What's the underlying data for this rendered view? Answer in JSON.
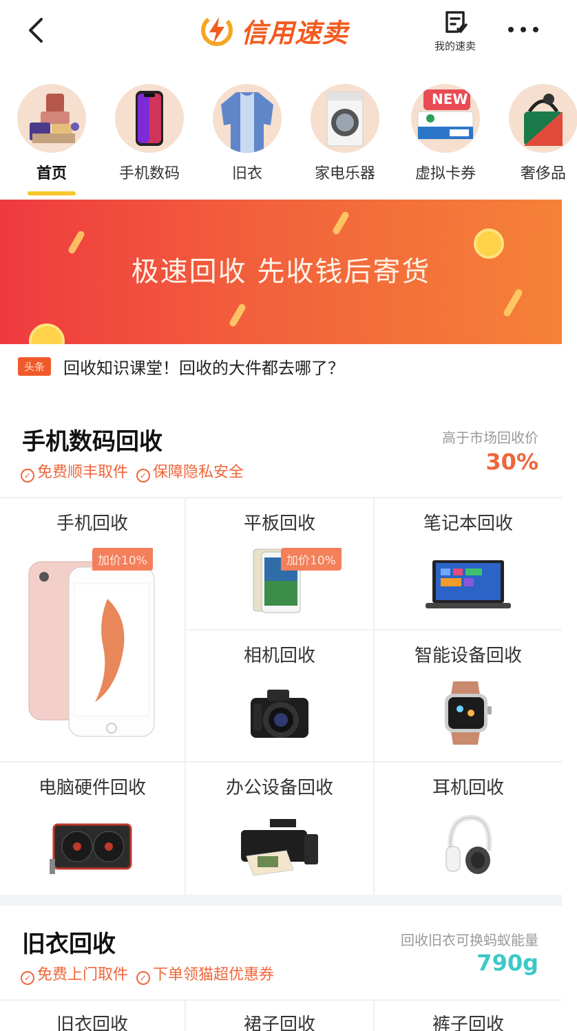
{
  "header": {
    "logo_text": "信用速卖",
    "my_sell_label": "我的速卖"
  },
  "categories": [
    {
      "label": "首页",
      "active": true
    },
    {
      "label": "手机数码",
      "active": false
    },
    {
      "label": "旧衣",
      "active": false
    },
    {
      "label": "家电乐器",
      "active": false
    },
    {
      "label": "虚拟卡券",
      "active": false,
      "badge": "NEW"
    },
    {
      "label": "奢侈品",
      "active": false
    }
  ],
  "banner": {
    "text": "极速回收  先收钱后寄货"
  },
  "news": {
    "tag": "头条",
    "text": "回收知识课堂！回收的大件都去哪了？"
  },
  "digital_section": {
    "title": "手机数码回收",
    "tags": [
      "免费顺丰取件",
      "保障隐私安全"
    ],
    "right_label": "高于市场回收价",
    "right_value": "30%",
    "items": [
      {
        "title": "手机回收",
        "tag": "加价10%"
      },
      {
        "title": "平板回收",
        "tag": "加价10%"
      },
      {
        "title": "笔记本回收"
      },
      {
        "title": "相机回收"
      },
      {
        "title": "智能设备回收"
      },
      {
        "title": "电脑硬件回收"
      },
      {
        "title": "办公设备回收"
      },
      {
        "title": "耳机回收"
      }
    ]
  },
  "clothes_section": {
    "title": "旧衣回收",
    "tags": [
      "免费上门取件",
      "下单领猫超优惠券"
    ],
    "right_label": "回收旧衣可换蚂蚁能量",
    "right_value": "790g",
    "items": [
      {
        "title": "旧衣回收"
      },
      {
        "title": "裙子回收"
      },
      {
        "title": "裤子回收"
      }
    ]
  },
  "colors": {
    "brand": "#f35b1f",
    "accent_orange": "#f0653a",
    "teal": "#3cc8c8",
    "underline": "#f7c72a"
  }
}
